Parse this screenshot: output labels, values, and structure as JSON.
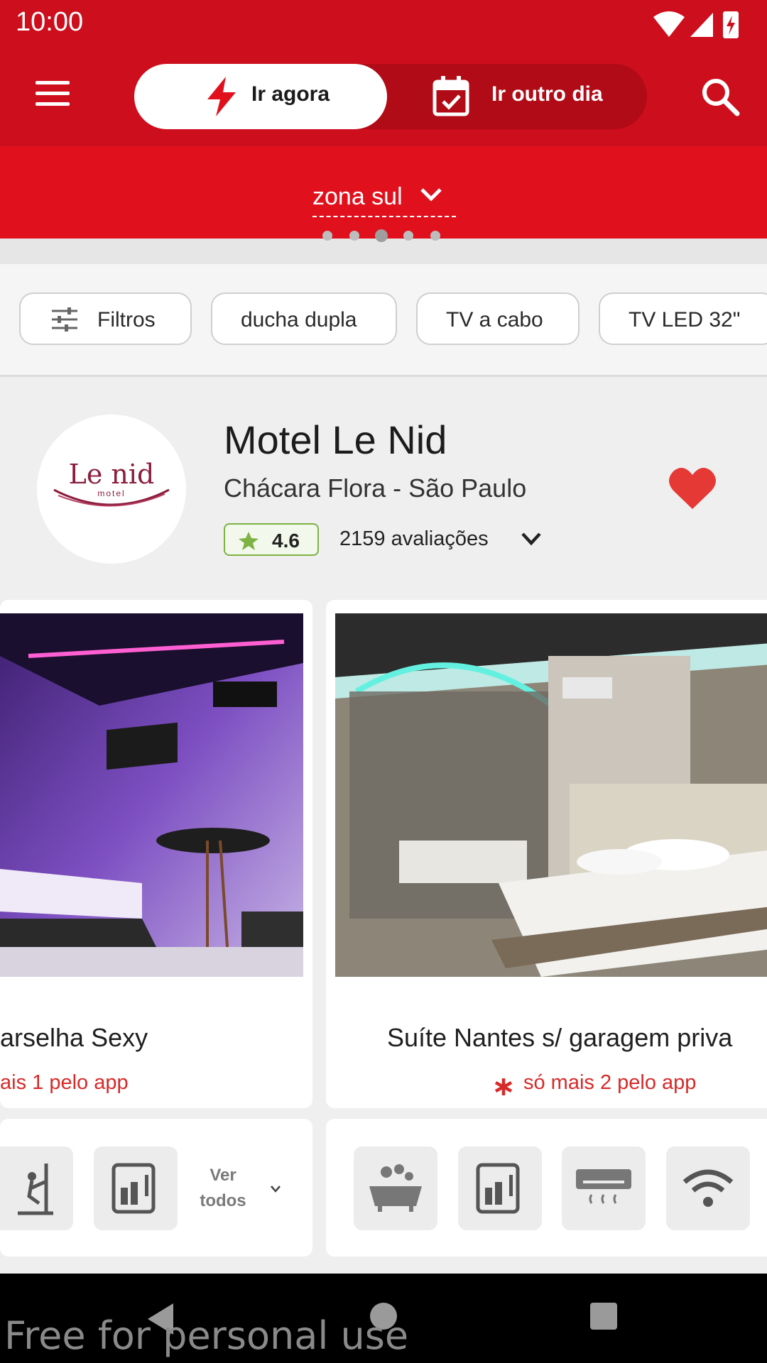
{
  "status": {
    "time": "10:00"
  },
  "topbar": {
    "menu_icon": "hamburger-menu-icon",
    "tab_now_label": "Ir agora",
    "tab_now_icon": "lightning-icon",
    "tab_other_label": "Ir outro dia",
    "tab_other_icon": "calendar-check-icon",
    "search_icon": "search-icon",
    "brand_color": "#cd0e1c"
  },
  "zone": {
    "label": "zona sul",
    "chevron_icon": "chevron-down-icon"
  },
  "filters": {
    "filter_button_label": "Filtros",
    "chips": [
      "ducha dupla",
      "TV a cabo",
      "TV LED 32\""
    ]
  },
  "motel": {
    "logo_text": "Le nid",
    "logo_subtext": "motel",
    "name": "Motel Le Nid",
    "location": "Chácara Flora - São Paulo",
    "rating": "4.6",
    "reviews": "2159 avaliações",
    "favorite_icon": "heart-icon",
    "rating_color": "#7cb342"
  },
  "rooms": [
    {
      "name": "arselha Sexy",
      "promo": "ais 1 pelo app"
    },
    {
      "name": "Suíte Nantes s/ garagem priva",
      "promo": "só mais 2 pelo app"
    }
  ],
  "amenities": {
    "see_all": [
      "Ver",
      "todos"
    ],
    "card1_icons": [
      "pole-dance-icon",
      "minibar-icon"
    ],
    "card2_icons": [
      "bathtub-icon",
      "minibar-icon",
      "air-conditioner-icon",
      "wifi-icon"
    ]
  },
  "watermark": "Free for personal use"
}
